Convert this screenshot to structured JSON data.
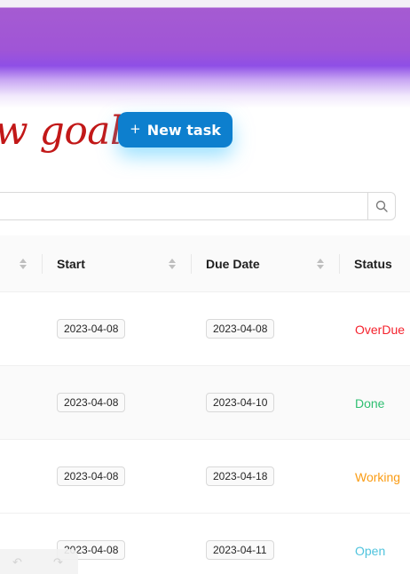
{
  "header": {
    "goal_title": "w goal",
    "new_task_label": "New task"
  },
  "search": {
    "placeholder": ""
  },
  "table": {
    "columns": [
      "Start",
      "Due Date",
      "Status"
    ],
    "rows": [
      {
        "start": "2023-04-08",
        "due": "2023-04-08",
        "status": "OverDue",
        "status_color": "#f5222d"
      },
      {
        "start": "2023-04-08",
        "due": "2023-04-10",
        "status": "Done",
        "status_color": "#2fbf71"
      },
      {
        "start": "2023-04-08",
        "due": "2023-04-18",
        "status": "Working",
        "status_color": "#fa9c14"
      },
      {
        "start": "2023-04-08",
        "due": "2023-04-11",
        "status": "Open",
        "status_color": "#4fc3dd"
      }
    ]
  },
  "colors": {
    "banner": "#a055d6",
    "goal_title": "#c21818",
    "primary_button": "#0d7fce"
  }
}
